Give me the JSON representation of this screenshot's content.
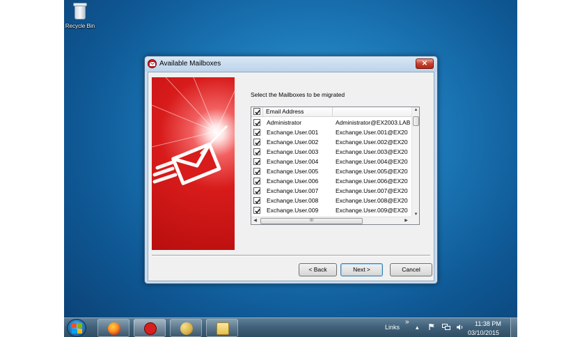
{
  "desktop": {
    "icons": [
      {
        "label": "Recycle Bin",
        "icon": "recycle-bin-icon"
      }
    ]
  },
  "dialog": {
    "title": "Available Mailboxes",
    "close_label": "✕",
    "instruction": "Select the Mailboxes to be migrated",
    "grid": {
      "columns": [
        "Email Address",
        ""
      ],
      "rows": [
        {
          "name": "Administrator",
          "email": "Administrator@EX2003.LAB",
          "checked": true
        },
        {
          "name": "Exchange.User.001",
          "email": "Exchange.User.001@EX20",
          "checked": true
        },
        {
          "name": "Exchange.User.002",
          "email": "Exchange.User.002@EX20",
          "checked": true
        },
        {
          "name": "Exchange.User.003",
          "email": "Exchange.User.003@EX20",
          "checked": true
        },
        {
          "name": "Exchange.User.004",
          "email": "Exchange.User.004@EX20",
          "checked": true
        },
        {
          "name": "Exchange.User.005",
          "email": "Exchange.User.005@EX20",
          "checked": true
        },
        {
          "name": "Exchange.User.006",
          "email": "Exchange.User.006@EX20",
          "checked": true
        },
        {
          "name": "Exchange.User.007",
          "email": "Exchange.User.007@EX20",
          "checked": true
        },
        {
          "name": "Exchange.User.008",
          "email": "Exchange.User.008@EX20",
          "checked": true
        },
        {
          "name": "Exchange.User.009",
          "email": "Exchange.User.009@EX20",
          "checked": true
        }
      ],
      "hscroll_grip": "III"
    },
    "buttons": {
      "back": "< Back",
      "next": "Next >",
      "cancel": "Cancel"
    }
  },
  "taskbar": {
    "pinned": [
      "firefox-icon",
      "mail-migration-app-icon",
      "paint-icon",
      "file-explorer-icon"
    ],
    "links_label": "Links",
    "links_chevron": "»",
    "tray_up_arrow": "▴",
    "time": "11:38 PM",
    "date": "03/10/2015"
  },
  "colors": {
    "accent_red": "#d81b1b",
    "taskbar": "#41627b",
    "desktop_blue": "#1d79b8"
  }
}
